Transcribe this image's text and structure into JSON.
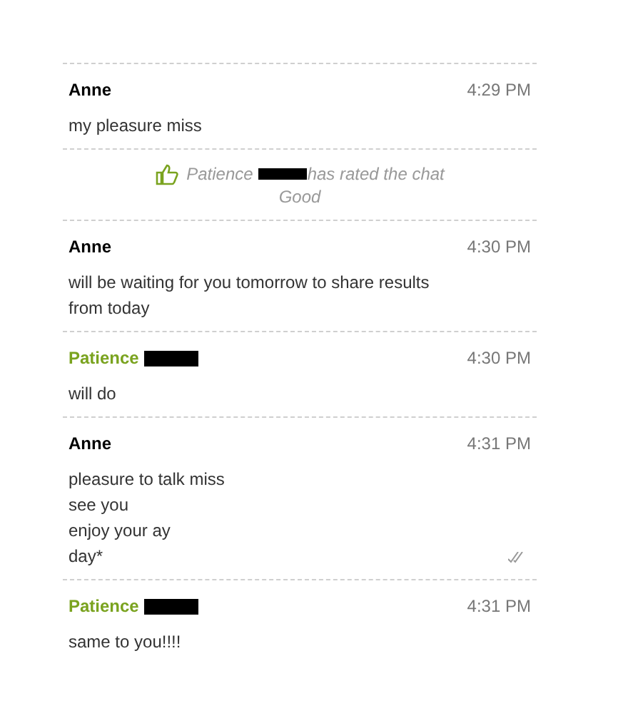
{
  "entries": [
    {
      "kind": "message",
      "sender": "Anne",
      "color": "#000000",
      "redacted": false,
      "time": "4:29 PM",
      "lines": [
        "my pleasure miss"
      ],
      "read": false
    },
    {
      "kind": "rating",
      "name": "Patience",
      "redacted": true,
      "text": "has rated the chat",
      "rating": "Good"
    },
    {
      "kind": "message",
      "sender": "Anne",
      "color": "#000000",
      "redacted": false,
      "time": "4:30 PM",
      "lines": [
        "will be waiting for you tomorrow to share results from today"
      ],
      "read": false
    },
    {
      "kind": "message",
      "sender": "Patience",
      "color": "#7aa31f",
      "redacted": true,
      "time": "4:30 PM",
      "lines": [
        "will do"
      ],
      "read": false
    },
    {
      "kind": "message",
      "sender": "Anne",
      "color": "#000000",
      "redacted": false,
      "time": "4:31 PM",
      "lines": [
        "pleasure to talk miss",
        "see you",
        "enjoy your ay",
        "day*"
      ],
      "read": true
    },
    {
      "kind": "message",
      "sender": "Patience",
      "color": "#7aa31f",
      "redacted": true,
      "time": "4:31 PM",
      "lines": [
        "same to you!!!!"
      ],
      "read": false
    }
  ]
}
